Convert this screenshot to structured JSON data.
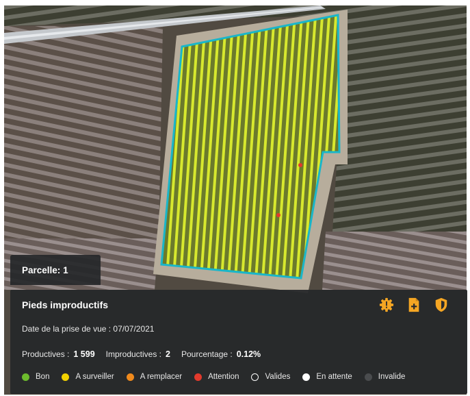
{
  "parcel": {
    "label": "Parcelle:",
    "value": "1"
  },
  "panel": {
    "title": "Pieds improductifs",
    "date_label": "Date de la prise de vue :",
    "date_value": "07/07/2021",
    "stats": {
      "productive_label": "Productives :",
      "productive_value": "1 599",
      "unproductive_label": "Improductives :",
      "unproductive_value": "2",
      "percent_label": "Pourcentage :",
      "percent_value": "0.12%"
    },
    "actions": [
      {
        "icon": "alert-gear-icon",
        "color": "#f5a623"
      },
      {
        "icon": "file-add-icon",
        "color": "#f5a623"
      },
      {
        "icon": "shield-icon",
        "color": "#f5a623"
      }
    ]
  },
  "legend": [
    {
      "label": "Bon",
      "color": "#6dbb2d",
      "style": "filled"
    },
    {
      "label": "A surveiller",
      "color": "#f2d200",
      "style": "filled"
    },
    {
      "label": "A remplacer",
      "color": "#f08a1c",
      "style": "filled"
    },
    {
      "label": "Attention",
      "color": "#e23a2c",
      "style": "filled"
    },
    {
      "label": "Valides",
      "color": "#ffffff",
      "style": "outline"
    },
    {
      "label": "En attente",
      "color": "#ffffff",
      "style": "filled"
    },
    {
      "label": "Invalide",
      "color": "#4a4c4e",
      "style": "filled"
    }
  ],
  "map": {
    "parcel_outline_color": "#19b6c9",
    "plant_color_good": "#c9e227",
    "plant_color_watch": "#f2d200",
    "plant_color_alert": "#e23a2c"
  }
}
